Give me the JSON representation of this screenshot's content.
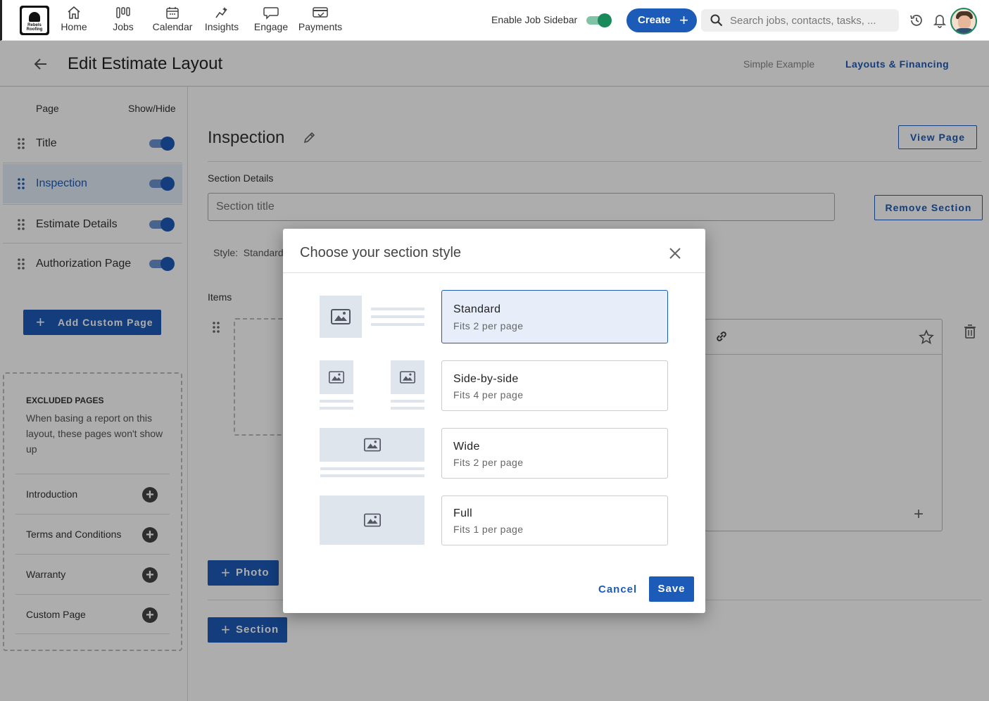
{
  "nav": {
    "logo_text": "Rebels Roofing",
    "items": [
      {
        "label": "Home",
        "icon": "home-icon"
      },
      {
        "label": "Jobs",
        "icon": "jobs-icon"
      },
      {
        "label": "Calendar",
        "icon": "calendar-icon"
      },
      {
        "label": "Insights",
        "icon": "insights-icon"
      },
      {
        "label": "Engage",
        "icon": "engage-icon"
      },
      {
        "label": "Payments",
        "icon": "payments-icon"
      }
    ],
    "job_sidebar_label": "Enable Job Sidebar",
    "create_label": "Create",
    "search_placeholder": "Search jobs, contacts, tasks, ..."
  },
  "header": {
    "title": "Edit Estimate Layout",
    "tabs": [
      "Simple Example",
      "Layouts & Financing"
    ]
  },
  "left": {
    "col_page": "Page",
    "col_show": "Show/Hide",
    "pages": [
      {
        "label": "Title",
        "shown": true
      },
      {
        "label": "Inspection",
        "shown": true,
        "active": true
      },
      {
        "label": "Estimate Details",
        "shown": true
      },
      {
        "label": "Authorization Page",
        "shown": true
      }
    ],
    "add_custom_label": "Add Custom Page",
    "excluded_title": "EXCLUDED PAGES",
    "excluded_desc": "When basing a report on this layout, these pages won't show up",
    "excluded_pages": [
      "Introduction",
      "Terms and Conditions",
      "Warranty",
      "Custom Page"
    ]
  },
  "main": {
    "section_title": "Inspection",
    "view_page_label": "View Page",
    "section_details_label": "Section Details",
    "section_title_placeholder": "Section title",
    "remove_section_label": "Remove Section",
    "style_label": "Style:",
    "style_value": "Standard",
    "items_label": "Items",
    "photo_label": "Photo",
    "section_label": "Section"
  },
  "dialog": {
    "title": "Choose your section style",
    "options": [
      {
        "name": "Standard",
        "sub": "Fits 2 per page",
        "selected": true
      },
      {
        "name": "Side-by-side",
        "sub": "Fits 4 per page"
      },
      {
        "name": "Wide",
        "sub": "Fits 2 per page"
      },
      {
        "name": "Full",
        "sub": "Fits 1 per page"
      }
    ],
    "cancel_label": "Cancel",
    "save_label": "Save"
  },
  "colors": {
    "primary": "#1c5bb8",
    "toggle_green": "#1b8a5a",
    "option_selected_bg": "#e7eef9"
  }
}
